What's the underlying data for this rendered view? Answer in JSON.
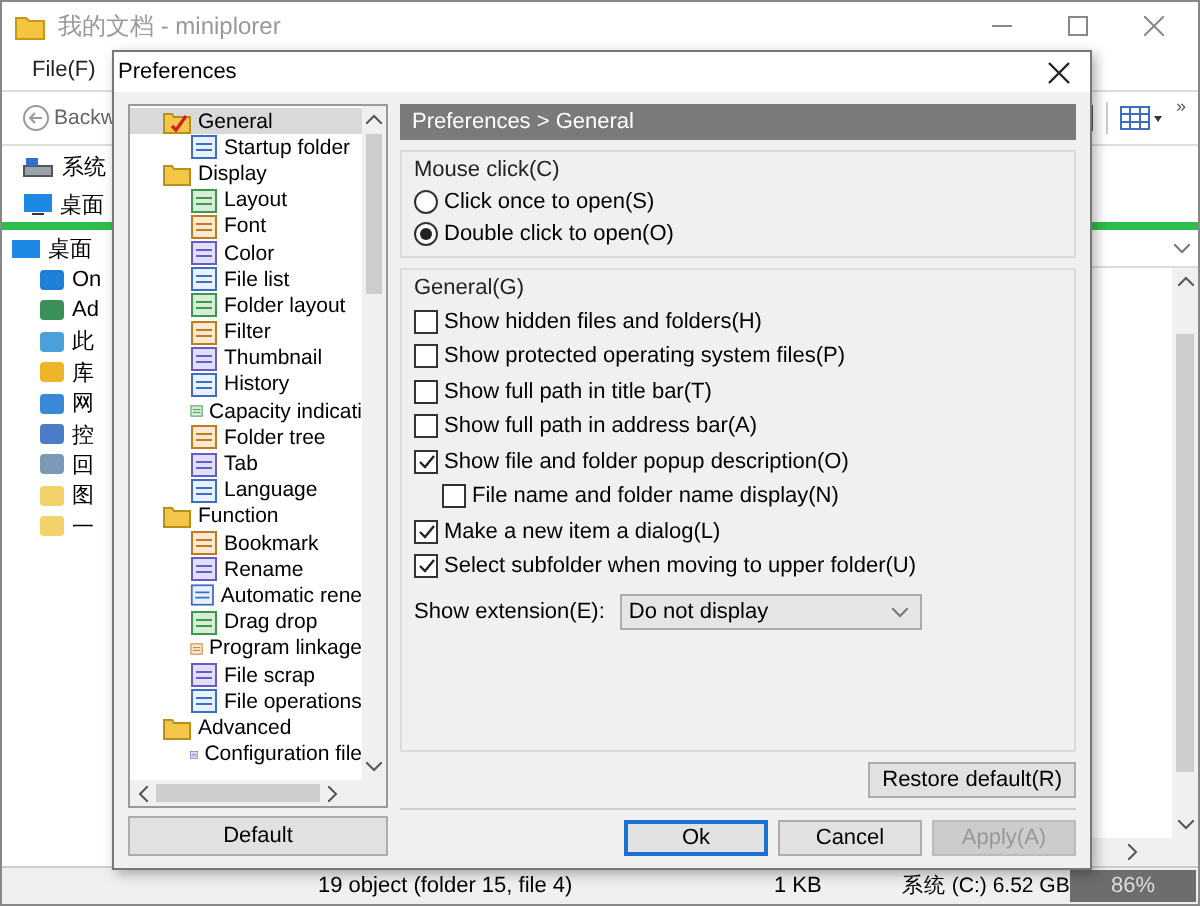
{
  "window": {
    "title": "我的文档 - miniplorer"
  },
  "menu": [
    {
      "label": "File(F)"
    }
  ],
  "toolbar": {
    "back": "Backw",
    "more": "»"
  },
  "drive": "系统",
  "tabs": [
    {
      "label": "桌面"
    }
  ],
  "tree": [
    {
      "label": "桌面",
      "children": [
        {
          "label": "On"
        },
        {
          "label": "Ad"
        },
        {
          "label": "此"
        },
        {
          "label": "库"
        },
        {
          "label": "网"
        },
        {
          "label": "控"
        },
        {
          "label": "回"
        },
        {
          "label": "图"
        },
        {
          "label": "一"
        }
      ]
    }
  ],
  "status_bar": {
    "objects": "19 object (folder 15, file 4)",
    "size": "1 KB",
    "drive": "系统 (C:) 6.52 GB",
    "usage": "86%"
  },
  "dialog": {
    "title": "Preferences",
    "tree": [
      {
        "label": "General",
        "selected": true,
        "children": [
          {
            "label": "Startup folder",
            "selected": false
          }
        ]
      },
      {
        "label": "Display",
        "selected": false,
        "children": [
          {
            "label": "Layout",
            "selected": false
          },
          {
            "label": "Font",
            "selected": false
          },
          {
            "label": "Color",
            "selected": false
          },
          {
            "label": "File list",
            "selected": false
          },
          {
            "label": "Folder layout",
            "selected": false
          },
          {
            "label": "Filter",
            "selected": false
          },
          {
            "label": "Thumbnail",
            "selected": false
          },
          {
            "label": "History",
            "selected": false
          },
          {
            "label": "Capacity indicati",
            "selected": false
          },
          {
            "label": "Folder tree",
            "selected": false
          },
          {
            "label": "Tab",
            "selected": false
          },
          {
            "label": "Language",
            "selected": false
          }
        ]
      },
      {
        "label": "Function",
        "selected": false,
        "children": [
          {
            "label": "Bookmark",
            "selected": false
          },
          {
            "label": "Rename",
            "selected": false
          },
          {
            "label": "Automatic rene",
            "selected": false
          },
          {
            "label": "Drag drop",
            "selected": false
          },
          {
            "label": "Program linkage",
            "selected": false
          },
          {
            "label": "File scrap",
            "selected": false
          },
          {
            "label": "File operations",
            "selected": false
          }
        ]
      },
      {
        "label": "Advanced",
        "selected": false,
        "children": [
          {
            "label": "Configuration file",
            "selected": false
          }
        ]
      }
    ],
    "default_button": "Default",
    "header": "Preferences > General",
    "mouse_click": {
      "title": "Mouse click(C)",
      "options": [
        {
          "label": "Click once to open(S)",
          "selected": false
        },
        {
          "label": "Double click to open(O)",
          "selected": true
        }
      ]
    },
    "general": {
      "title": "General(G)",
      "options": [
        {
          "label": "Show hidden files and folders(H)",
          "checked": false
        },
        {
          "label": "Show protected operating system files(P)",
          "checked": false
        },
        {
          "label": "Show full path in title bar(T)",
          "checked": false
        },
        {
          "label": "Show full path in address bar(A)",
          "checked": false
        },
        {
          "label": "Show file and folder popup description(O)",
          "checked": true,
          "children": [
            {
              "label": "File name and folder name display(N)",
              "checked": false
            }
          ]
        },
        {
          "label": "Make a new item a dialog(L)",
          "checked": true
        },
        {
          "label": "Select subfolder when moving to upper folder(U)",
          "checked": true
        }
      ],
      "extension": {
        "label": "Show extension(E):",
        "value": "Do not display"
      }
    },
    "restore_button": "Restore default(R)",
    "buttons": [
      {
        "label": "Ok",
        "default": true,
        "disabled": false
      },
      {
        "label": "Cancel",
        "default": false,
        "disabled": false
      },
      {
        "label": "Apply(A)",
        "default": false,
        "disabled": true
      }
    ]
  }
}
